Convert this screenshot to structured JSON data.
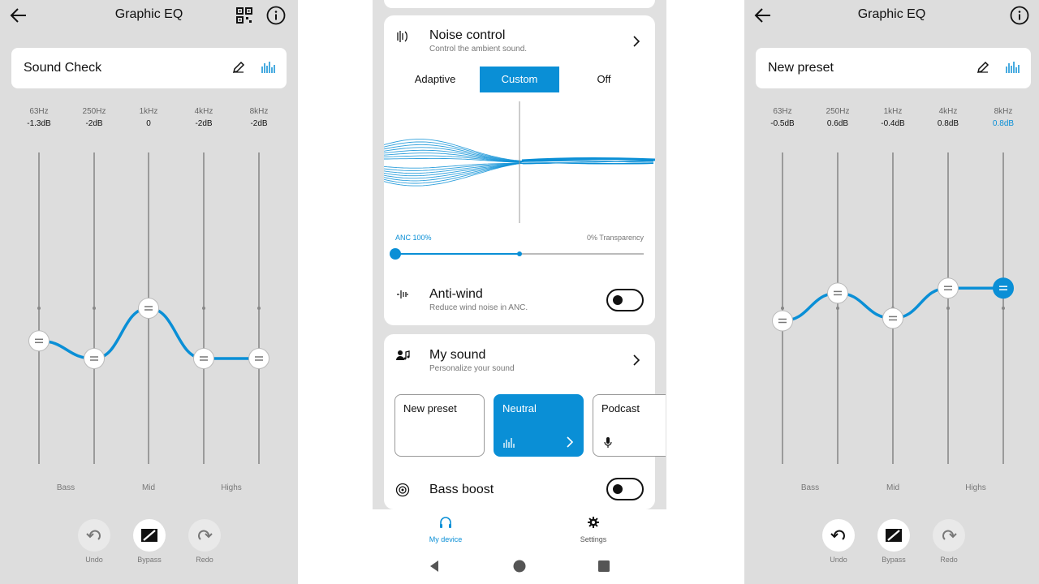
{
  "colors": {
    "accent": "#0a8fd6",
    "panel_bg": "#dddddd",
    "text": "#111111"
  },
  "left": {
    "title": "Graphic EQ",
    "preset_name": "Sound Check",
    "bands": [
      {
        "freq": "63Hz",
        "gain": "-1.3dB",
        "value": -1.3
      },
      {
        "freq": "250Hz",
        "gain": "-2dB",
        "value": -2
      },
      {
        "freq": "1kHz",
        "gain": "0",
        "value": 0
      },
      {
        "freq": "4kHz",
        "gain": "-2dB",
        "value": -2
      },
      {
        "freq": "8kHz",
        "gain": "-2dB",
        "value": -2
      }
    ],
    "groups": [
      "Bass",
      "Mid",
      "Highs"
    ],
    "controls": {
      "undo": "Undo",
      "bypass": "Bypass",
      "redo": "Redo"
    }
  },
  "middle": {
    "noise_control": {
      "title": "Noise control",
      "subtitle": "Control the ambient sound.",
      "modes": [
        "Adaptive",
        "Custom",
        "Off"
      ],
      "selected_mode": "Custom",
      "anc_label": "ANC 100%",
      "transparency_label": "0% Transparency",
      "slider_value": 0
    },
    "anti_wind": {
      "title": "Anti-wind",
      "subtitle": "Reduce wind noise in ANC.",
      "enabled": false
    },
    "my_sound": {
      "title": "My sound",
      "subtitle": "Personalize your sound",
      "presets": [
        "New preset",
        "Neutral",
        "Podcast"
      ],
      "selected": "Neutral"
    },
    "bass_boost": {
      "title": "Bass boost",
      "enabled": false
    },
    "nav": {
      "my_device": "My device",
      "settings": "Settings"
    }
  },
  "right": {
    "title": "Graphic EQ",
    "preset_name": "New preset",
    "bands": [
      {
        "freq": "63Hz",
        "gain": "-0.5dB",
        "value": -0.5
      },
      {
        "freq": "250Hz",
        "gain": "0.6dB",
        "value": 0.6
      },
      {
        "freq": "1kHz",
        "gain": "-0.4dB",
        "value": -0.4
      },
      {
        "freq": "4kHz",
        "gain": "0.8dB",
        "value": 0.8
      },
      {
        "freq": "8kHz",
        "gain": "0.8dB",
        "value": 0.8
      }
    ],
    "selected_band": 4,
    "groups": [
      "Bass",
      "Mid",
      "Highs"
    ],
    "controls": {
      "undo": "Undo",
      "bypass": "Bypass",
      "redo": "Redo"
    }
  }
}
